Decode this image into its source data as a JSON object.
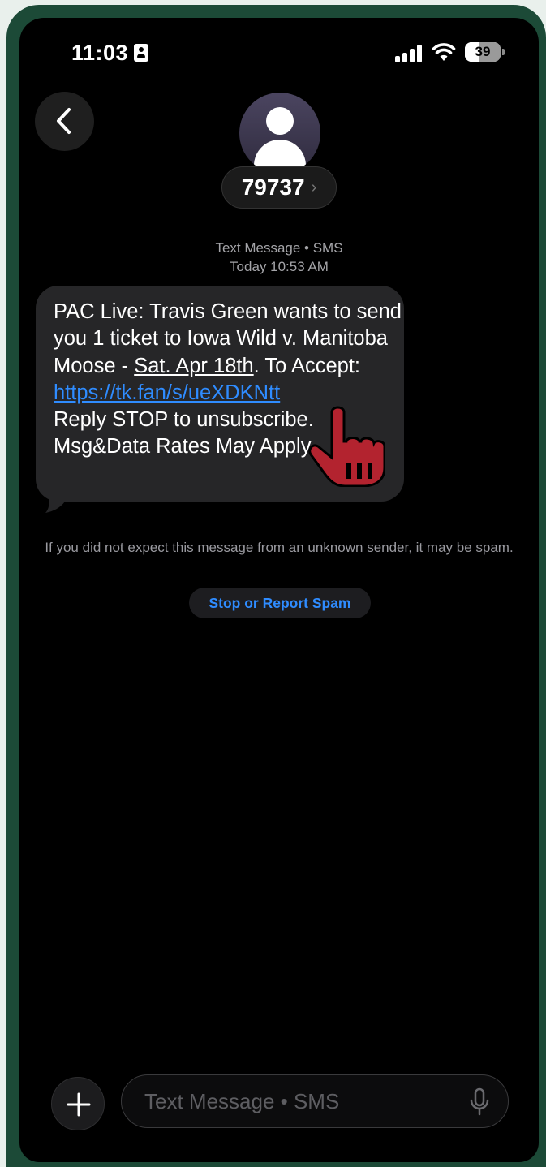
{
  "status_bar": {
    "time": "11:03",
    "contact_card_icon": "person-card-icon",
    "signal_icon": "cellular-signal-icon",
    "wifi_icon": "wifi-icon",
    "battery_level": "39",
    "battery_fraction": 0.39
  },
  "header": {
    "back_icon": "chevron-left-icon",
    "avatar_icon": "person-avatar-icon",
    "contact_name": "79737",
    "contact_chevron": "›"
  },
  "conversation": {
    "service_label": "Text Message • SMS",
    "timestamp": "Today 10:53 AM",
    "message": {
      "part1": "PAC Live: Travis Green wants to send you 1 ticket to Iowa Wild v. Manitoba Moose - ",
      "date_link": "Sat. Apr 18th",
      "part2": ". To Accept: ",
      "url_link": "https://tk.fan/s/ueXDKNtt",
      "part3": "Reply STOP to unsubscribe. Msg&Data Rates May Apply."
    },
    "overlay_icon": "pointing-hand-cursor-icon"
  },
  "spam_notice": {
    "warning": "If you did not expect this message from an unknown sender, it may be spam.",
    "button_label": "Stop or Report Spam"
  },
  "composer": {
    "plus_icon": "plus-icon",
    "placeholder": "Text Message • SMS",
    "mic_icon": "microphone-icon"
  },
  "colors": {
    "frame": "#1c4a37",
    "background": "#000000",
    "bubble": "#262628",
    "link": "#2f8cff",
    "hand": "#b3232f"
  }
}
